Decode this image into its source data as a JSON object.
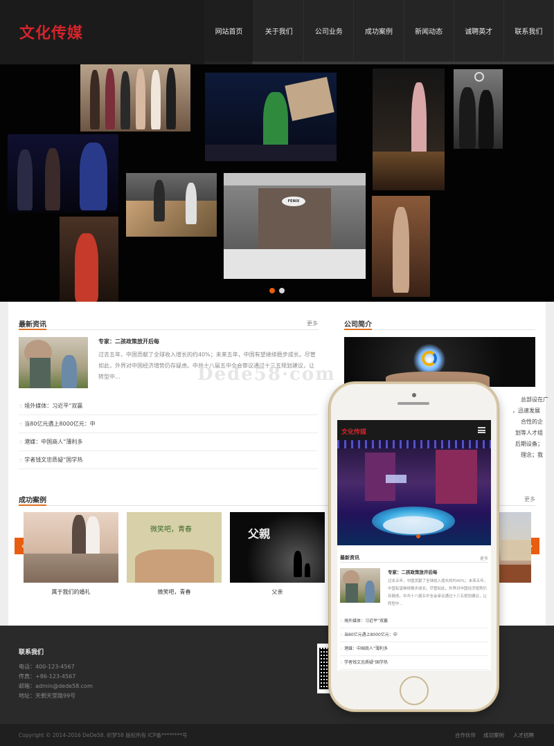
{
  "header": {
    "logo": "文化传媒",
    "nav": [
      "网站首页",
      "关于我们",
      "公司业务",
      "成功案例",
      "新闻动态",
      "诚聘英才",
      "联系我们"
    ]
  },
  "banner": {
    "active_slide": 1,
    "slide_count": 2
  },
  "news": {
    "title": "最新资讯",
    "more": "更多",
    "featured": {
      "headline": "专家：二孩政策放开后每",
      "summary": "过去五年，中国贡献了全球收入增长的约40%；未来五年，中国有望继续稳步成长。尽管如此，外界对中国经济增势仍存疑虑。中共十八届五中全会审议通过十三五规划建议，让转型中..."
    },
    "items": [
      "境外媒体：习近平“双赢",
      "当80亿元遇上8000亿元：中",
      "港媒：中国商人“薄利多",
      "学者钱文忠质疑“国学热"
    ]
  },
  "about": {
    "title": "公司简介",
    "fragments": [
      "总部设在广",
      "，迅速发展",
      "合性的企",
      "划等人才组",
      "后期设备；",
      "理念；我"
    ]
  },
  "cases": {
    "title": "成功案例",
    "more": "更多",
    "items": [
      {
        "label": "属于我们的婚礼"
      },
      {
        "label": "微笑吧，青春",
        "image_text": "微笑吧，青春"
      },
      {
        "label": "父亲",
        "image_text": "父親"
      }
    ],
    "prev_icon": "‹",
    "next_icon": "›"
  },
  "footer": {
    "contact_title": "联系我们",
    "lines": [
      "电话：400-123-4567",
      "传真：+86-123-4567",
      "邮箱：admin@dede58.com",
      "地址：天朝天堂路99号"
    ],
    "copyright": "Copyright © 2014-2016 DeDe58. 织梦58 版权所有    ICP备********号",
    "links": [
      "合作伙伴",
      "成功案例",
      "人才招聘"
    ]
  },
  "watermark": "Dede58·com",
  "mobile": {
    "logo": "文化传媒",
    "news_title": "最新资讯",
    "more": "更多",
    "headline": "专家：二孩政策放开后每",
    "summary": "过去五年，中国贡献了全球收入增长的约40%；未来五年，中国有望继续稳步成长。尽管如此，外界对中国经济增势仍存疑虑。中共十八届五中全会审议通过十三五规划建议，让转型中...",
    "items": [
      "境外媒体：习近平“双赢",
      "当80亿元遇上8000亿元：中",
      "港媒：中国商人“薄利多",
      "学者钱文忠质疑“国学热"
    ]
  },
  "colors": {
    "accent": "#e85d10",
    "brand_red": "#d6242a",
    "header_bg": "#1b1b1b"
  }
}
